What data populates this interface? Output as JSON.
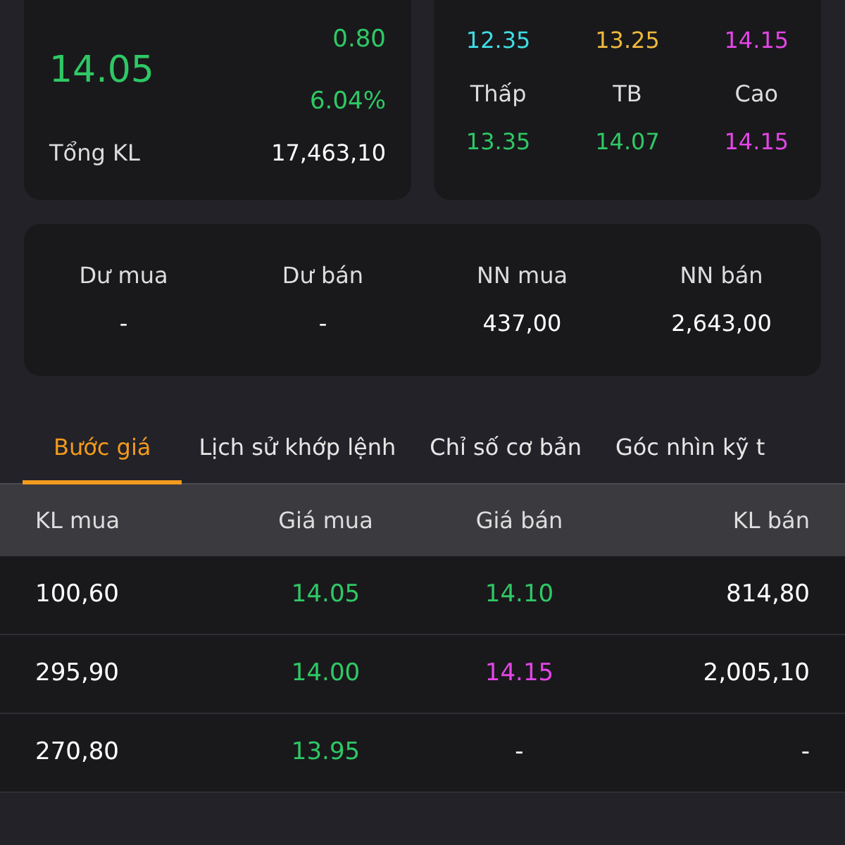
{
  "summary": {
    "price": "14.05",
    "change": "0.80",
    "change_pct": "6.04%",
    "total_volume_label": "Tổng KL",
    "total_volume": "17,463,10"
  },
  "price_levels": [
    {
      "value": "12.35",
      "color": "#3fdde3"
    },
    {
      "value": "13.25",
      "color": "#eeb83c"
    },
    {
      "value": "14.15",
      "color": "#e445e6"
    },
    {
      "label": "Thấp",
      "value": "13.35",
      "color": "#2fc864"
    },
    {
      "label": "TB",
      "value": "14.07",
      "color": "#2fc864"
    },
    {
      "label": "Cao",
      "value": "14.15",
      "color": "#e445e6"
    }
  ],
  "order_stats": [
    {
      "label": "Dư mua",
      "value": "-"
    },
    {
      "label": "Dư bán",
      "value": "-"
    },
    {
      "label": "NN mua",
      "value": "437,00"
    },
    {
      "label": "NN bán",
      "value": "2,643,00"
    }
  ],
  "tabs": [
    {
      "label": "Bước giá",
      "selected": true
    },
    {
      "label": "Lịch sử khớp lệnh",
      "selected": false
    },
    {
      "label": "Chỉ số cơ bản",
      "selected": false
    },
    {
      "label": "Góc nhìn kỹ t",
      "selected": false
    }
  ],
  "table": {
    "columns": [
      "KL mua",
      "Giá mua",
      "Giá bán",
      "KL bán"
    ],
    "rows": [
      [
        {
          "text": "100,60",
          "color": "#ffffff"
        },
        {
          "text": "14.05",
          "color": "#2fc864"
        },
        {
          "text": "14.10",
          "color": "#2fc864"
        },
        {
          "text": "814,80",
          "color": "#ffffff"
        }
      ],
      [
        {
          "text": "295,90",
          "color": "#ffffff"
        },
        {
          "text": "14.00",
          "color": "#2fc864"
        },
        {
          "text": "14.15",
          "color": "#e445e6"
        },
        {
          "text": "2,005,10",
          "color": "#ffffff"
        }
      ],
      [
        {
          "text": "270,80",
          "color": "#ffffff"
        },
        {
          "text": "13.95",
          "color": "#2fc864"
        },
        {
          "text": "-",
          "color": "#ffffff"
        },
        {
          "text": "-",
          "color": "#ffffff"
        }
      ]
    ]
  }
}
